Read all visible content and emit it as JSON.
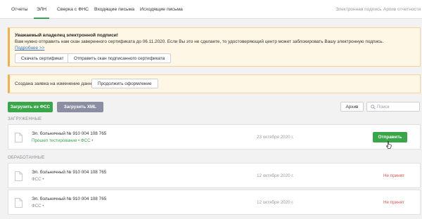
{
  "nav": {
    "tabs": [
      {
        "label": "Отчеты"
      },
      {
        "label": "ЭЛН"
      },
      {
        "label": "Сверка с ФНС"
      },
      {
        "label": "Входящие письма"
      },
      {
        "label": "Исходящие письма"
      }
    ],
    "right_links": [
      {
        "label": "Электронная подпись"
      },
      {
        "label": "Архив отчетности"
      }
    ]
  },
  "notice": {
    "title": "Уважаемый владелец электронной подписи!",
    "text": "Вам нужно отправить нам скан заверенного сертификата до 06.11.2020. Если Вы это не сделаете, то удостоверяющий центр может заблокировать Вашу электронную подпись.",
    "link": "Подробнее >>",
    "download_button": "Скачать сертификат",
    "send_scan_button": "Отправить скан подписанного сертификата"
  },
  "request": {
    "text": "Создана заявка на изменение данных",
    "continue_button": "Продолжить оформление"
  },
  "actions": {
    "upload_fss": "Загрузить из ФСС",
    "upload_xml": "Загрузить XML",
    "archive": "Архив",
    "search_placeholder": "Поиск"
  },
  "loaded": {
    "label": "ЗАГРУЖЕННЫЕ",
    "items": [
      {
        "title": "Эл. больничный № 910 004 108 765",
        "status": "Прошел тестирование • ФСС •",
        "date": "23 октября 2020 г.",
        "action": "Отправить"
      }
    ]
  },
  "processed": {
    "label": "ОБРАБОТАННЫЕ",
    "items": [
      {
        "title": "Эл. больничный № 910 004 108 765",
        "status": "ФСС •",
        "date": "12 октября 2020 г.",
        "result": "Не принят"
      },
      {
        "title": "Эл. больничный № 910 004 108 765",
        "status": "ФСС •",
        "date": "12 октября 2020 г.",
        "result": "Не принят"
      }
    ]
  },
  "colors": {
    "accent_green": "#3aa64a",
    "warning_border": "#f2b046",
    "error_red": "#e05252",
    "link_blue": "#3a73c2"
  }
}
